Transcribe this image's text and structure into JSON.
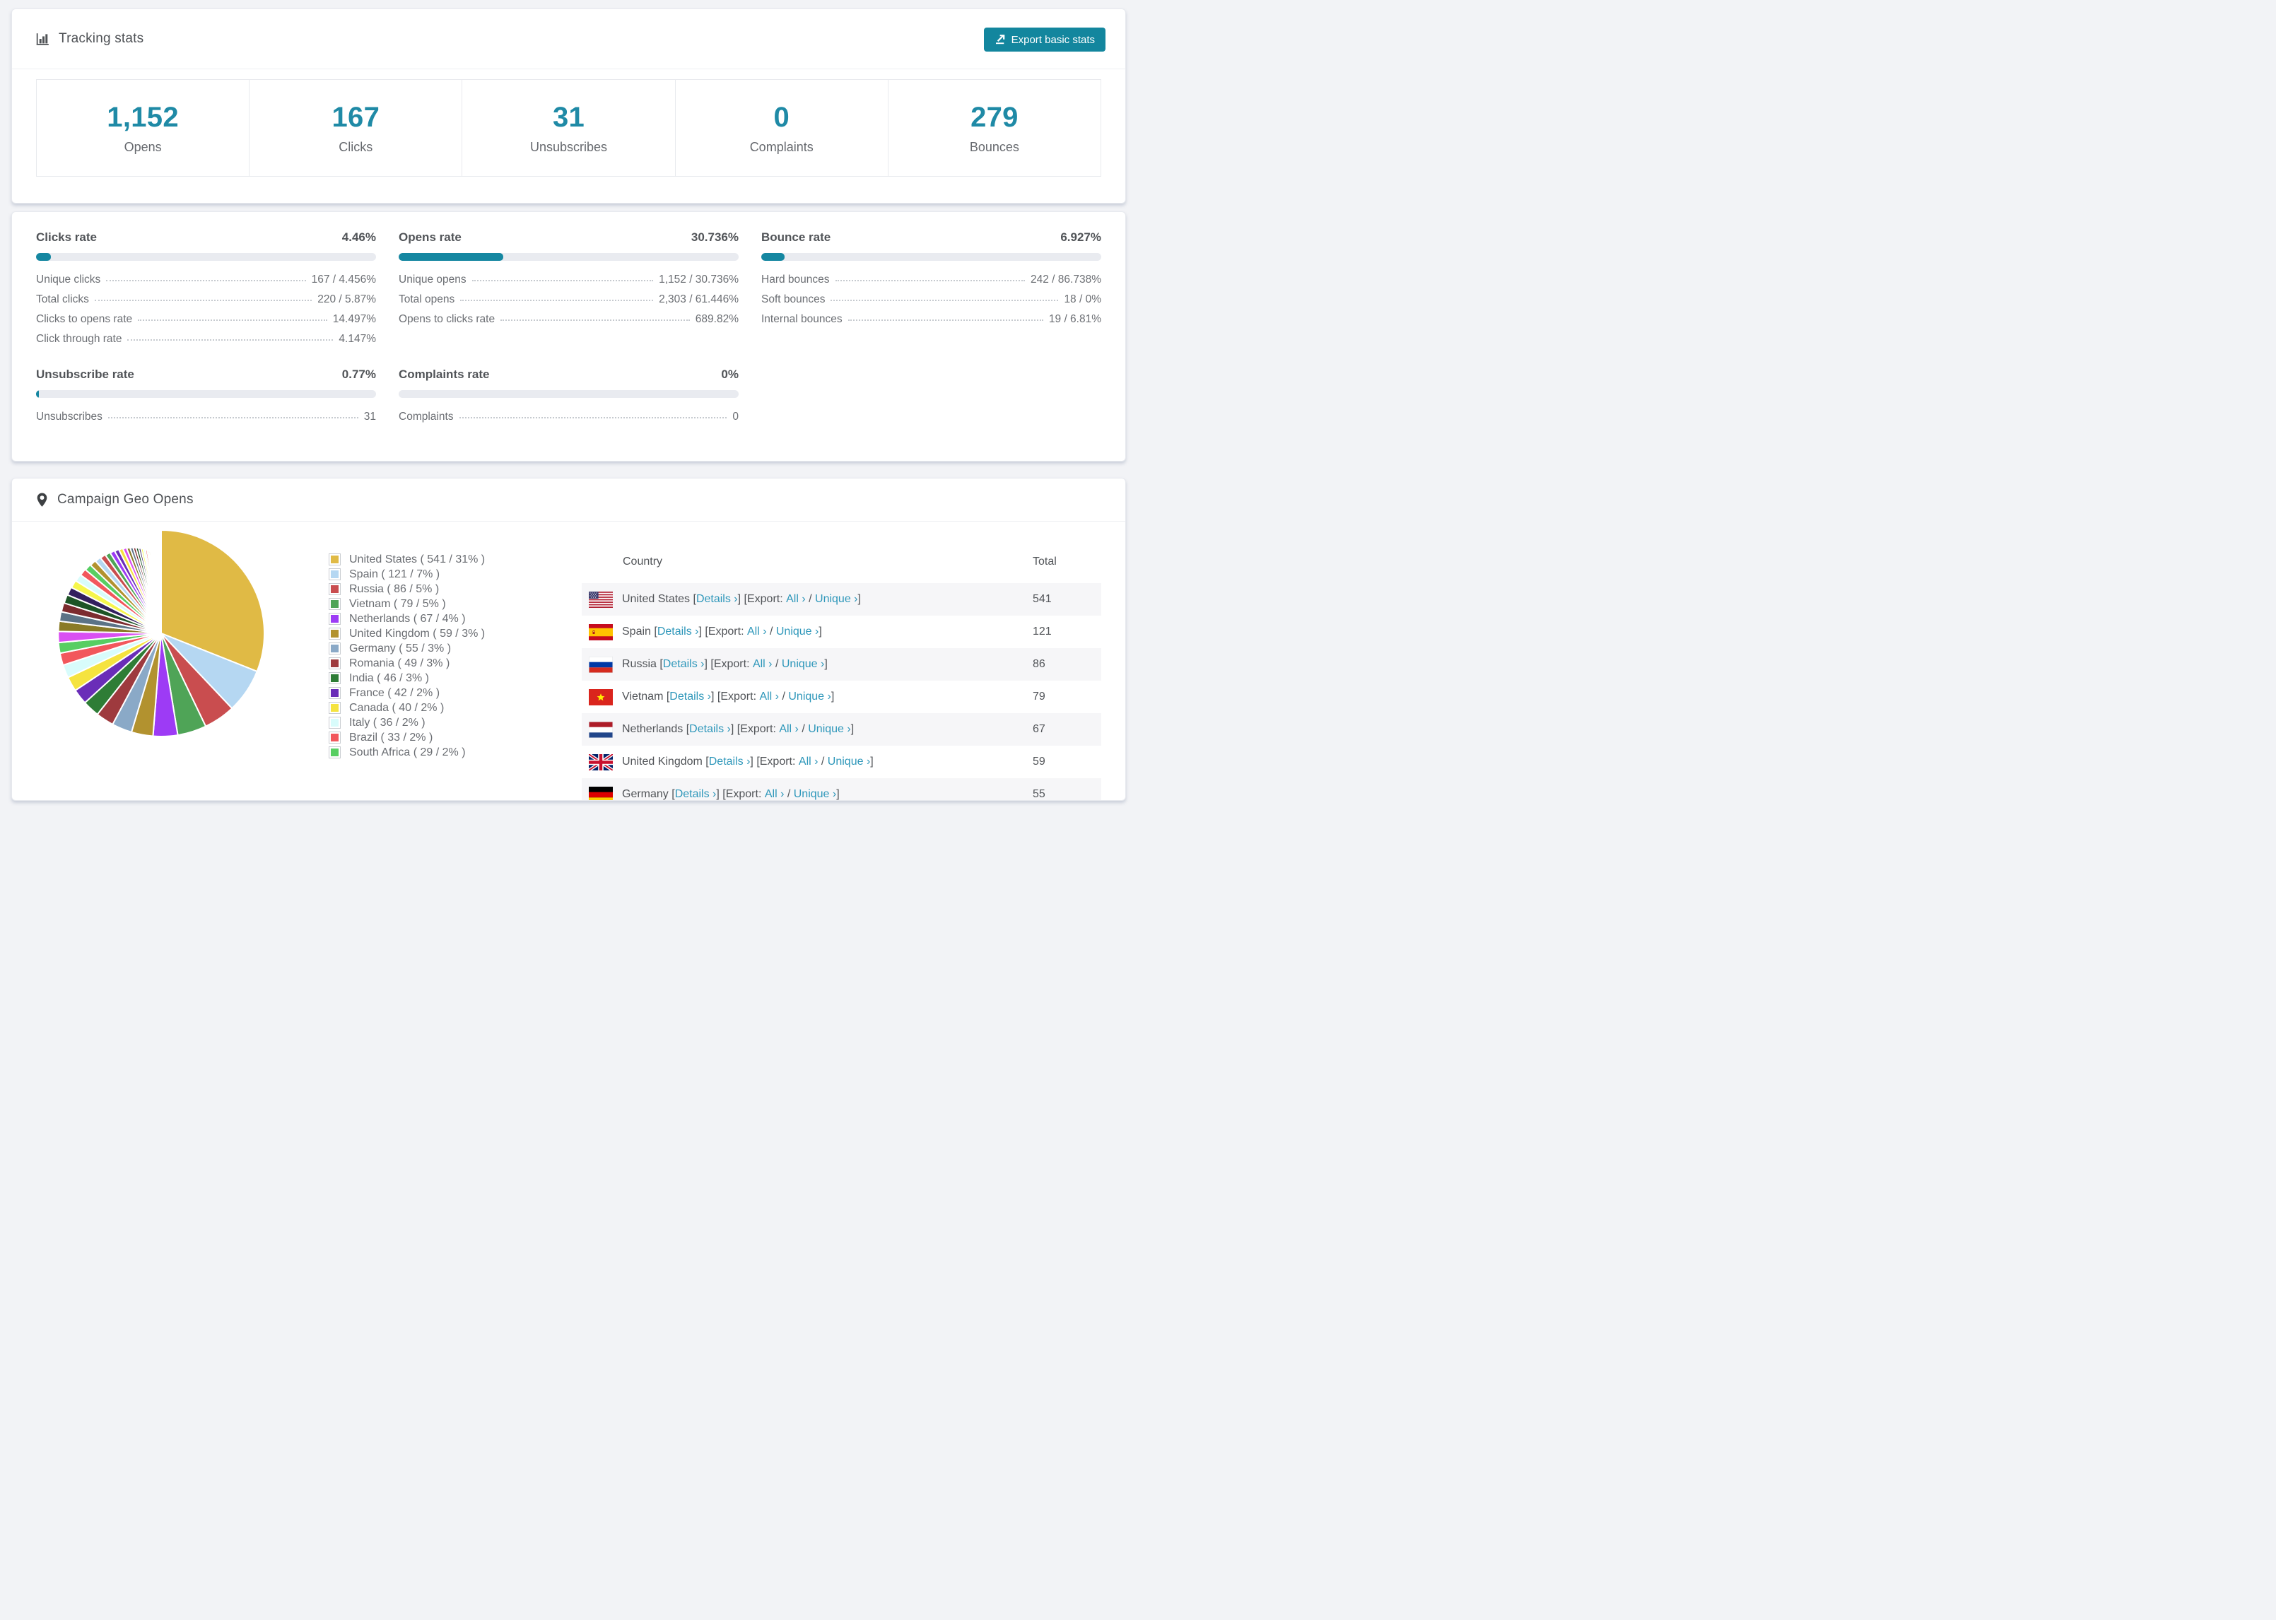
{
  "accent": "#13869e",
  "tracking_card": {
    "title": "Tracking stats",
    "export_button_label": "Export basic stats",
    "stats": [
      {
        "value": "1,152",
        "label": "Opens"
      },
      {
        "value": "167",
        "label": "Clicks"
      },
      {
        "value": "31",
        "label": "Unsubscribes"
      },
      {
        "value": "0",
        "label": "Complaints"
      },
      {
        "value": "279",
        "label": "Bounces"
      }
    ]
  },
  "rates_card": {
    "blocks": [
      {
        "title": "Clicks rate",
        "value": "4.46%",
        "percent": 4.46,
        "rows": [
          {
            "label": "Unique clicks",
            "value": "167 / 4.456%"
          },
          {
            "label": "Total clicks",
            "value": "220 / 5.87%"
          },
          {
            "label": "Clicks to opens rate",
            "value": "14.497%"
          },
          {
            "label": "Click through rate",
            "value": "4.147%"
          }
        ]
      },
      {
        "title": "Opens rate",
        "value": "30.736%",
        "percent": 30.736,
        "rows": [
          {
            "label": "Unique opens",
            "value": "1,152 / 30.736%"
          },
          {
            "label": "Total opens",
            "value": "2,303 / 61.446%"
          },
          {
            "label": "Opens to clicks rate",
            "value": "689.82%"
          }
        ]
      },
      {
        "title": "Bounce rate",
        "value": "6.927%",
        "percent": 6.927,
        "rows": [
          {
            "label": "Hard bounces",
            "value": "242 / 86.738%"
          },
          {
            "label": "Soft bounces",
            "value": "18 / 0%"
          },
          {
            "label": "Internal bounces",
            "value": "19 / 6.81%"
          }
        ]
      },
      {
        "title": "Unsubscribe rate",
        "value": "0.77%",
        "percent": 0.77,
        "rows": [
          {
            "label": "Unsubscribes",
            "value": "31"
          }
        ]
      },
      {
        "title": "Complaints rate",
        "value": "0%",
        "percent": 0,
        "rows": [
          {
            "label": "Complaints",
            "value": "0"
          }
        ]
      }
    ]
  },
  "geo_card": {
    "title": "Campaign Geo Opens",
    "columns": {
      "country": "Country",
      "total": "Total"
    },
    "tokens": {
      "lb": " [",
      "export": "] [Export: ",
      "slash": " / ",
      "rb": "]"
    },
    "links": {
      "details": "Details ›",
      "all": "All ›",
      "unique": "Unique ›"
    },
    "rows": [
      {
        "country": "United States",
        "total": "541",
        "flag": "us"
      },
      {
        "country": "Spain",
        "total": "121",
        "flag": "es"
      },
      {
        "country": "Russia",
        "total": "86",
        "flag": "ru"
      },
      {
        "country": "Vietnam",
        "total": "79",
        "flag": "vn"
      },
      {
        "country": "Netherlands",
        "total": "67",
        "flag": "nl"
      },
      {
        "country": "United Kingdom",
        "total": "59",
        "flag": "gb"
      },
      {
        "country": "Germany",
        "total": "55",
        "flag": "de"
      }
    ]
  },
  "chart_data": {
    "type": "pie",
    "title": "Campaign Geo Opens",
    "legend_position": "right",
    "legend_tokens": {
      "open": " ( ",
      "sep": " / ",
      "close": " )"
    },
    "series": [
      {
        "label": "United States",
        "value": 541,
        "pct": "31%",
        "color": "#e0ba45"
      },
      {
        "label": "Spain",
        "value": 121,
        "pct": "7%",
        "color": "#b5d7f2"
      },
      {
        "label": "Russia",
        "value": 86,
        "pct": "5%",
        "color": "#c94d4f"
      },
      {
        "label": "Vietnam",
        "value": 79,
        "pct": "5%",
        "color": "#4fa457"
      },
      {
        "label": "Netherlands",
        "value": 67,
        "pct": "4%",
        "color": "#9d3bf5"
      },
      {
        "label": "United Kingdom",
        "value": 59,
        "pct": "3%",
        "color": "#b2922f"
      },
      {
        "label": "Germany",
        "value": 55,
        "pct": "3%",
        "color": "#8aa9c7"
      },
      {
        "label": "Romania",
        "value": 49,
        "pct": "3%",
        "color": "#9e3a3e"
      },
      {
        "label": "India",
        "value": 46,
        "pct": "3%",
        "color": "#2e7d36"
      },
      {
        "label": "France",
        "value": 42,
        "pct": "2%",
        "color": "#6a2db8"
      },
      {
        "label": "Canada",
        "value": 40,
        "pct": "2%",
        "color": "#f5e33f"
      },
      {
        "label": "Italy",
        "value": 36,
        "pct": "2%",
        "color": "#d8fcfb"
      },
      {
        "label": "Brazil",
        "value": 33,
        "pct": "2%",
        "color": "#f2575c"
      },
      {
        "label": "South Africa",
        "value": 29,
        "pct": "2%",
        "color": "#57ce62"
      }
    ],
    "others": {
      "note": "many small unlabeled country slices; values estimated from slice angles",
      "estimated_total": 461,
      "weights": [
        30,
        28,
        26,
        25,
        24,
        23,
        22,
        21,
        20,
        19,
        18,
        17,
        16,
        15,
        14,
        13,
        12,
        11,
        10,
        9,
        8,
        8,
        7,
        7,
        6,
        6,
        5,
        5,
        4,
        4,
        3,
        3,
        2,
        2,
        2,
        2,
        1,
        1,
        1,
        1,
        1,
        1,
        1,
        1,
        1,
        1,
        1,
        1,
        1,
        1
      ],
      "palette": [
        "#d94ff2",
        "#8a7b26",
        "#5b7386",
        "#7c2b2e",
        "#1d5426",
        "#33205e",
        "#f6f64c",
        "#d8fcfb",
        "#f2575c",
        "#57ce62",
        "#b2922f",
        "#b5d7f2",
        "#c94d4f",
        "#4fa457",
        "#9d3bf5",
        "#6a2db8",
        "#f5e33f"
      ]
    }
  }
}
